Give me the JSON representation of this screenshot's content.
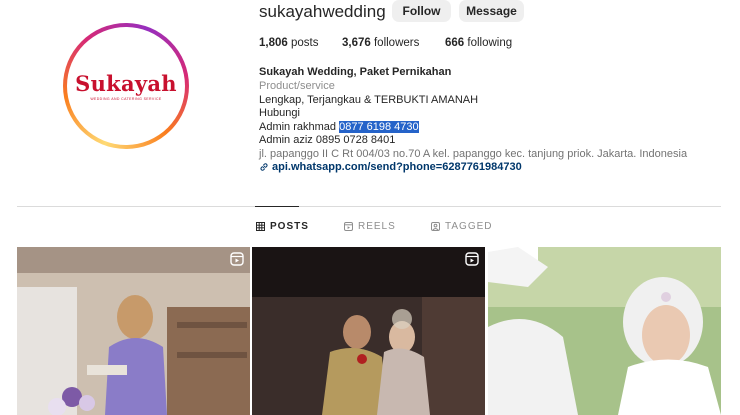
{
  "profile": {
    "username": "sukayahwedding",
    "follow_label": "Follow",
    "message_label": "Message",
    "stats": {
      "posts_count": "1,806",
      "posts_label": "posts",
      "followers_count": "3,676",
      "followers_label": "followers",
      "following_count": "666",
      "following_label": "following"
    },
    "avatar": {
      "logo_text": "Sukayah",
      "logo_subtext": "WEDDING AND CATERING SERVICE"
    },
    "bio": {
      "name": "Sukayah Wedding, Paket Pernikahan",
      "category": "Product/service",
      "line1": "Lengkap, Terjangkau & TERBUKTI AMANAH",
      "line2": "Hubungi",
      "admin1_prefix": "Admin rakhmad ",
      "admin1_phone": "0877 6198 4730",
      "admin2": "Admin aziz 0895 0728 8401",
      "address": "jl. papanggo II C Rt 004/03 no.70 A kel. papanggo kec. tanjung priok. Jakarta. Indonesia",
      "link": "api.whatsapp.com/send?phone=6287761984730"
    }
  },
  "tabs": [
    {
      "label": "POSTS",
      "icon": "grid-icon",
      "active": true
    },
    {
      "label": "REELS",
      "icon": "reels-icon",
      "active": false
    },
    {
      "label": "TAGGED",
      "icon": "tagged-icon",
      "active": false
    }
  ],
  "posts": [
    {
      "type": "reel",
      "icon": "reel-icon"
    },
    {
      "type": "reel",
      "icon": "reel-icon"
    },
    {
      "type": "photo"
    }
  ],
  "colors": {
    "highlight": "#2563c9",
    "link": "#00376b",
    "logo": "#c8102e"
  }
}
